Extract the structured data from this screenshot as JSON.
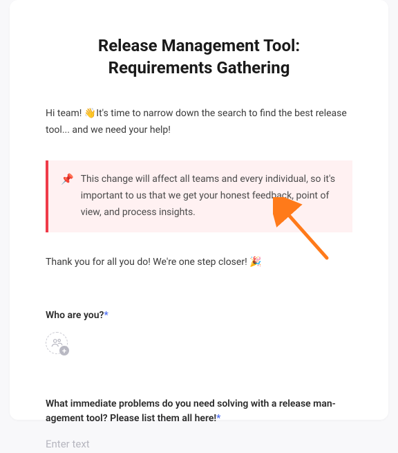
{
  "title": "Release Management Tool: Requirements Gathering",
  "intro_prefix": "Hi team! ",
  "intro_emoji": "👋",
  "intro_rest": "It's time to narrow down the search to find the best release tool... and we need your help!",
  "callout": {
    "icon": "📌",
    "text": "This change will affect all teams and every individual, so it's important to us that we get your honest feedback, point of view, and process insights."
  },
  "thanks_prefix": "Thank you for all you do! We're one step closer! ",
  "thanks_emoji": "🎉",
  "questions": {
    "who": {
      "label": "Who are you?",
      "required_mark": "*"
    },
    "problems": {
      "label": "What immediate problems do you need solving with a release man­agement tool? Please list them all here!",
      "required_mark": "*",
      "placeholder": "Enter text"
    }
  }
}
